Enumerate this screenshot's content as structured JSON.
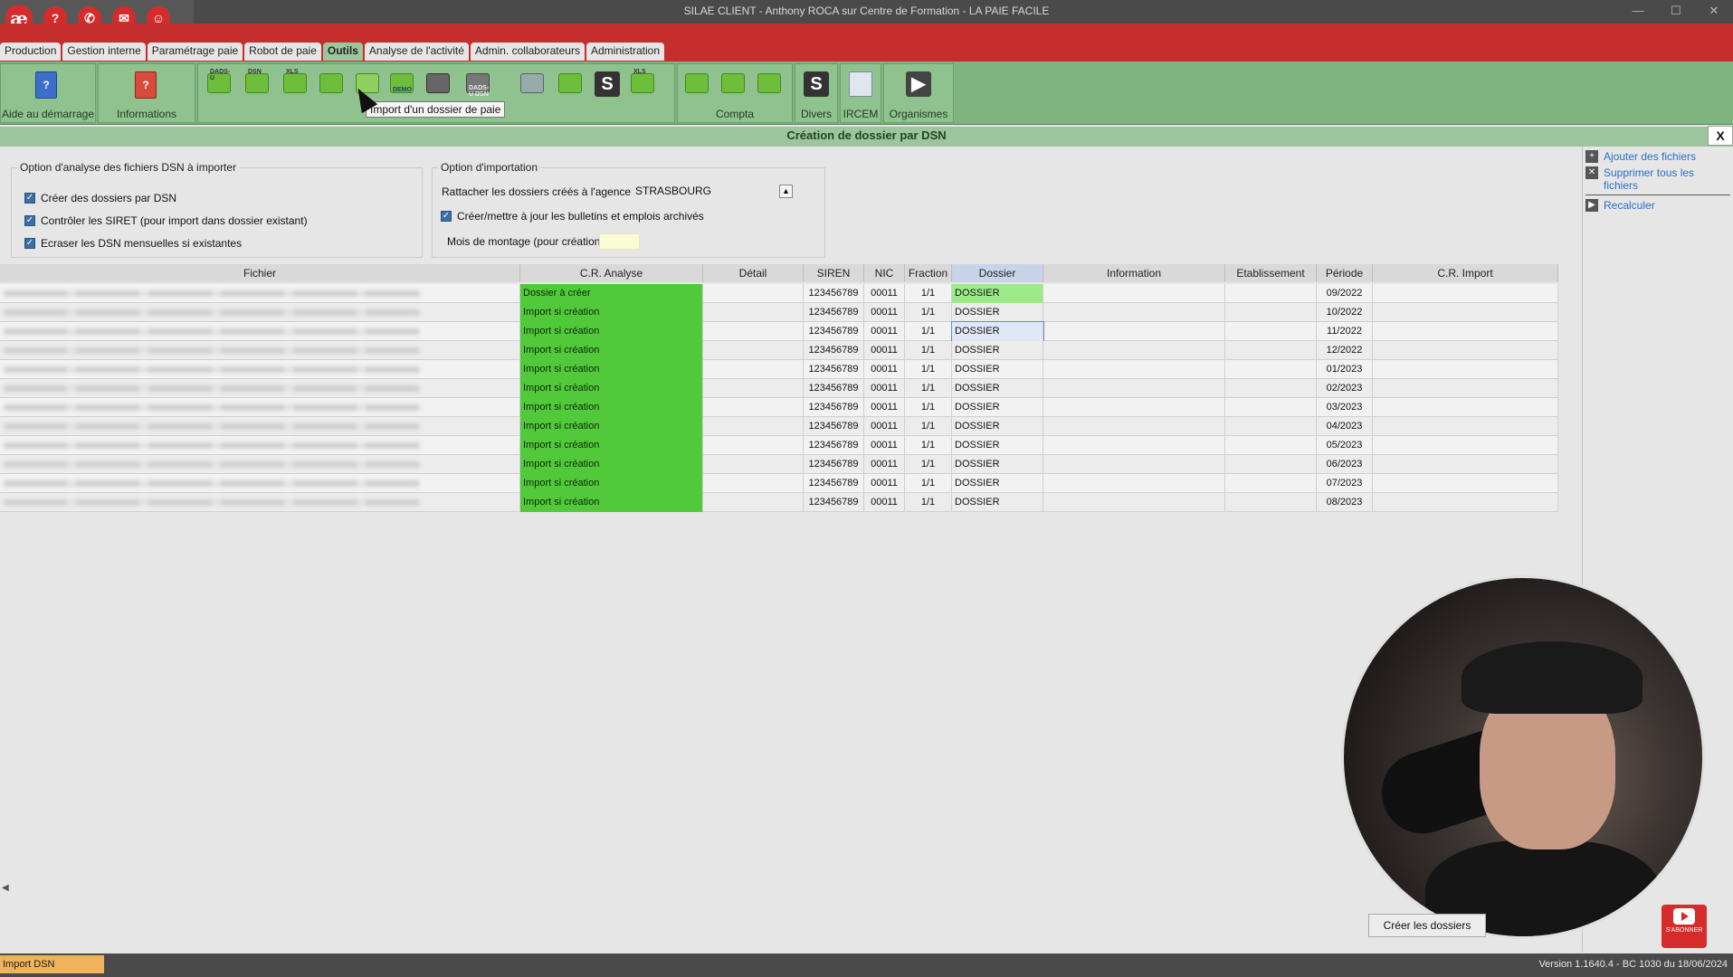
{
  "window": {
    "title": "SILAE CLIENT - Anthony ROCA sur Centre de Formation - LA PAIE FACILE",
    "logo_text": "æ"
  },
  "quick_access": [
    "?",
    "✆",
    "✉",
    "☺"
  ],
  "menu_tabs": [
    {
      "label": "Production"
    },
    {
      "label": "Gestion interne"
    },
    {
      "label": "Paramétrage paie"
    },
    {
      "label": "Robot de paie"
    },
    {
      "label": "Outils",
      "active": true
    },
    {
      "label": "Analyse de l'activité"
    },
    {
      "label": "Admin. collaborateurs"
    },
    {
      "label": "Administration"
    }
  ],
  "ribbon": {
    "aide_label": "Aide au démarrage",
    "info_label": "Informations",
    "compta_label": "Compta",
    "divers_label": "Divers",
    "ircem_label": "IRCEM",
    "organismes_label": "Organismes",
    "icon_tags": [
      "DADS-U",
      "DSN",
      "XLS",
      "DEMO",
      "DADS-U DSN",
      "XLS"
    ],
    "tooltip": "Import d'un dossier de paie"
  },
  "panel": {
    "title": "Création de dossier par DSN",
    "close_label": "X"
  },
  "analysis_options": {
    "legend": "Option d'analyse des fichiers DSN à importer",
    "items": [
      {
        "label": "Créer des dossiers par DSN",
        "checked": true
      },
      {
        "label": "Contrôler les SIRET (pour import dans dossier existant)",
        "checked": true
      },
      {
        "label": "Ecraser les DSN mensuelles si existantes",
        "checked": true
      }
    ]
  },
  "import_options": {
    "legend": "Option d'importation",
    "agency_label": "Rattacher les dossiers créés à l'agence :",
    "agency_value": "STRASBOURG",
    "archive_label": "Créer/mettre à jour les bulletins et emplois archivés",
    "archive_checked": true,
    "month_label": "Mois de montage (pour création) :",
    "month_value": ""
  },
  "side_actions": {
    "add_files": "Ajouter des fichiers",
    "remove_files": "Supprimer tous les fichiers",
    "recalc": "Recalculer"
  },
  "table": {
    "columns": [
      "Fichier",
      "C.R. Analyse",
      "Détail",
      "SIREN",
      "NIC",
      "Fraction",
      "Dossier",
      "Information",
      "Etablissement",
      "Période",
      "C.R. Import"
    ],
    "rows": [
      {
        "cr": "Dossier à créer",
        "siren": "123456789",
        "nic": "00011",
        "fraction": "1/1",
        "dossier": "DOSSIER",
        "periode": "09/2022"
      },
      {
        "cr": "Import si création",
        "siren": "123456789",
        "nic": "00011",
        "fraction": "1/1",
        "dossier": "DOSSIER",
        "periode": "10/2022"
      },
      {
        "cr": "Import si création",
        "siren": "123456789",
        "nic": "00011",
        "fraction": "1/1",
        "dossier": "DOSSIER",
        "periode": "11/2022"
      },
      {
        "cr": "Import si création",
        "siren": "123456789",
        "nic": "00011",
        "fraction": "1/1",
        "dossier": "DOSSIER",
        "periode": "12/2022"
      },
      {
        "cr": "Import si création",
        "siren": "123456789",
        "nic": "00011",
        "fraction": "1/1",
        "dossier": "DOSSIER",
        "periode": "01/2023"
      },
      {
        "cr": "Import si création",
        "siren": "123456789",
        "nic": "00011",
        "fraction": "1/1",
        "dossier": "DOSSIER",
        "periode": "02/2023"
      },
      {
        "cr": "Import si création",
        "siren": "123456789",
        "nic": "00011",
        "fraction": "1/1",
        "dossier": "DOSSIER",
        "periode": "03/2023"
      },
      {
        "cr": "Import si création",
        "siren": "123456789",
        "nic": "00011",
        "fraction": "1/1",
        "dossier": "DOSSIER",
        "periode": "04/2023"
      },
      {
        "cr": "Import si création",
        "siren": "123456789",
        "nic": "00011",
        "fraction": "1/1",
        "dossier": "DOSSIER",
        "periode": "05/2023"
      },
      {
        "cr": "Import si création",
        "siren": "123456789",
        "nic": "00011",
        "fraction": "1/1",
        "dossier": "DOSSIER",
        "periode": "06/2023"
      },
      {
        "cr": "Import si création",
        "siren": "123456789",
        "nic": "00011",
        "fraction": "1/1",
        "dossier": "DOSSIER",
        "periode": "07/2023"
      },
      {
        "cr": "Import si création",
        "siren": "123456789",
        "nic": "00011",
        "fraction": "1/1",
        "dossier": "DOSSIER",
        "periode": "08/2023"
      }
    ]
  },
  "footer": {
    "create_button": "Créer les dossiers",
    "status_left": "Import DSN",
    "version": "Version 1.1640.4 - BC 1030 du 18/06/2024",
    "subscribe_label": "S'ABONNER"
  },
  "colors": {
    "menu_red": "#c62d2d",
    "ribbon_green": "#7fb37f",
    "status_green": "#52c93b",
    "status_orange": "#f0b25a"
  }
}
